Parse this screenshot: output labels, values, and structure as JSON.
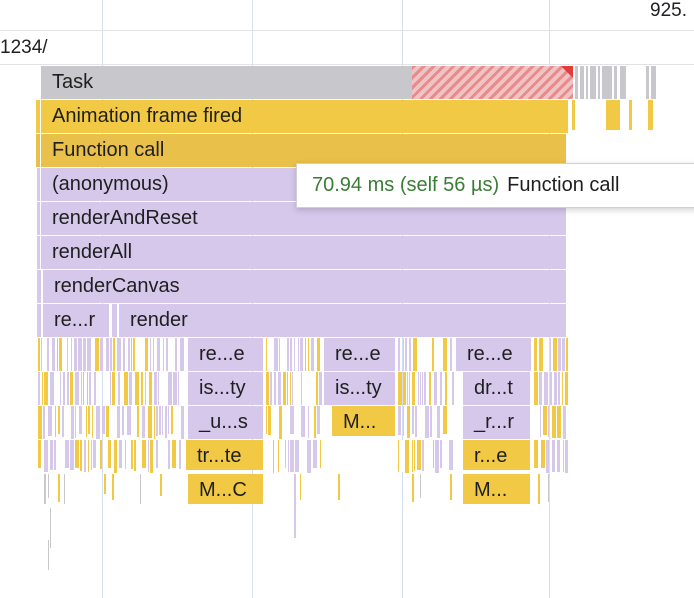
{
  "ruler": {
    "time_label": "925.",
    "url_fragment": "1234/"
  },
  "flame": {
    "task": "Task",
    "animation_frame": "Animation frame fired",
    "function_call": "Function call",
    "anonymous": "(anonymous)",
    "render_and_reset": "renderAndReset",
    "render_all": "renderAll",
    "render_canvas": "renderCanvas",
    "row9": {
      "left": "re...r",
      "right": "render"
    },
    "row10": [
      "re...e",
      "re...e",
      "re...e"
    ],
    "row11": [
      "is...ty",
      "is...ty",
      "dr...t"
    ],
    "row12": [
      "_u...s",
      "M...",
      "_r...r"
    ],
    "row13": [
      "tr...te",
      "r...e"
    ],
    "row14": [
      "M...C",
      "M..."
    ]
  },
  "tooltip": {
    "time": "70.94 ms (self 56 µs)",
    "name": "Function call"
  },
  "colors": {
    "script_yellow": "#f1c945",
    "frame_purple": "#d6c8eb",
    "task_gray": "#c8c8cc",
    "long_task_red": "#e43a3a",
    "tooltip_time_green": "#3a7d36"
  }
}
